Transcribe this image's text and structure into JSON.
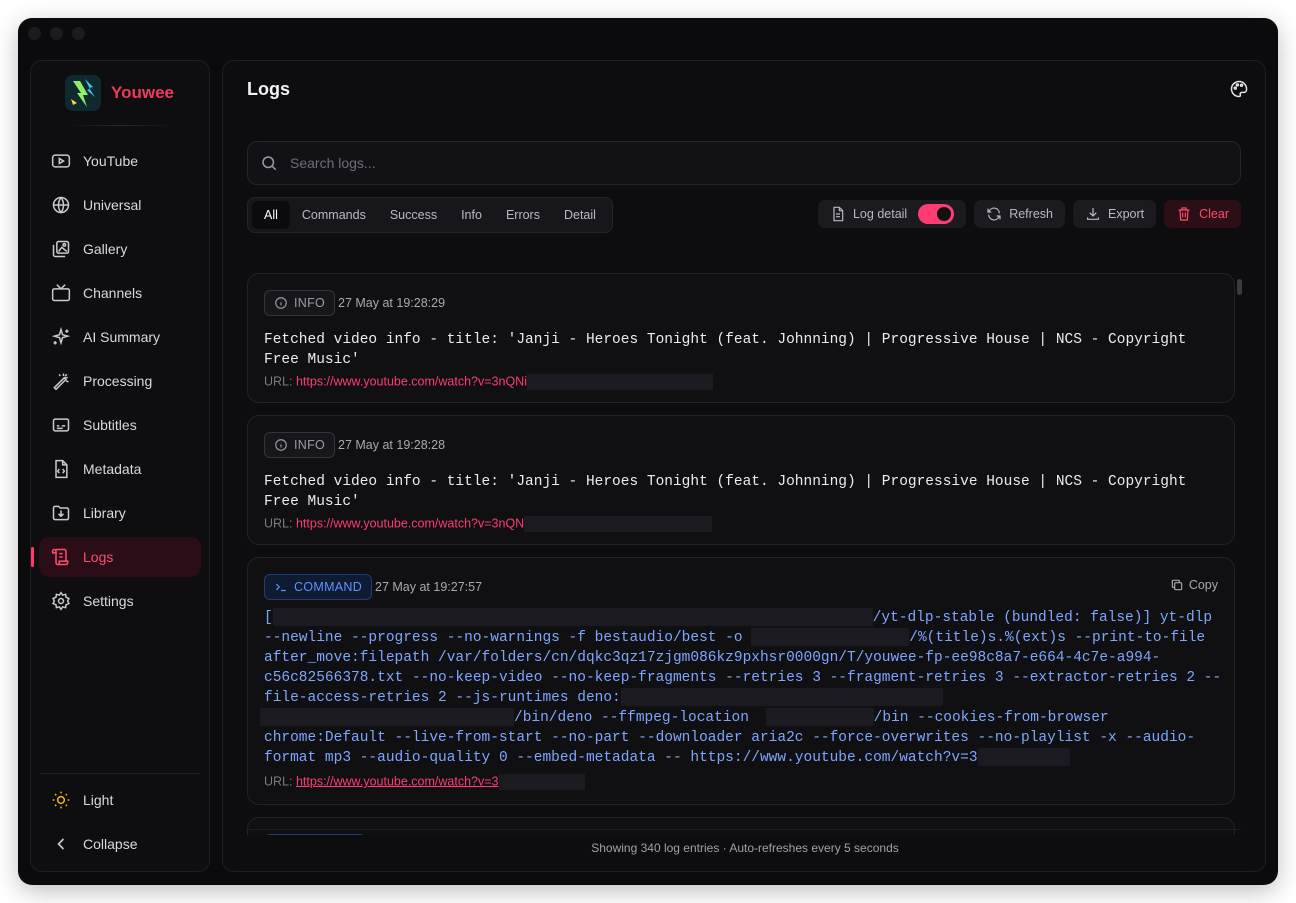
{
  "app": {
    "name": "Youwee"
  },
  "sidebar": {
    "items": [
      {
        "label": "YouTube",
        "icon": "youtube-icon"
      },
      {
        "label": "Universal",
        "icon": "globe-icon"
      },
      {
        "label": "Gallery",
        "icon": "gallery-icon"
      },
      {
        "label": "Channels",
        "icon": "tv-icon"
      },
      {
        "label": "AI Summary",
        "icon": "sparkles-icon"
      },
      {
        "label": "Processing",
        "icon": "magic-wand-icon"
      },
      {
        "label": "Subtitles",
        "icon": "subtitles-icon"
      },
      {
        "label": "Metadata",
        "icon": "file-code-icon"
      },
      {
        "label": "Library",
        "icon": "folder-download-icon"
      },
      {
        "label": "Logs",
        "icon": "scroll-icon",
        "active": true
      },
      {
        "label": "Settings",
        "icon": "gear-icon"
      }
    ],
    "theme_label": "Light",
    "collapse_label": "Collapse"
  },
  "header": {
    "title": "Logs"
  },
  "search": {
    "placeholder": "Search logs..."
  },
  "filters": {
    "all": "All",
    "commands": "Commands",
    "success": "Success",
    "info": "Info",
    "errors": "Errors",
    "detail": "Detail",
    "selected": "All"
  },
  "actions": {
    "log_detail": "Log detail",
    "log_detail_on": true,
    "refresh": "Refresh",
    "export": "Export",
    "clear": "Clear"
  },
  "logs": [
    {
      "type": "INFO",
      "timestamp": "27 May at 19:28:29",
      "message": "Fetched video info - title: 'Janji - Heroes Tonight (feat. Johnning) | Progressive House | NCS - Copyright Free Music'",
      "url_label": "URL:",
      "url": "https://www.youtube.com/watch?v=3nQNi"
    },
    {
      "type": "INFO",
      "timestamp": "27 May at 19:28:28",
      "message": "Fetched video info - title: 'Janji - Heroes Tonight (feat. Johnning) | Progressive House | NCS - Copyright Free Music'",
      "url_label": "URL:",
      "url": "https://www.youtube.com/watch?v=3nQN"
    },
    {
      "type": "COMMAND",
      "timestamp": "27 May at 19:27:57",
      "copy_label": "Copy",
      "command_parts": {
        "p1": "[",
        "p2": "/yt-dlp-stable (bundled: false)] yt-dlp",
        "p3": "--newline --progress --no-warnings -f bestaudio/best -o",
        "p4": "/%(title)s.%(ext)s --print-to-file",
        "p5": "after_move:filepath /var/folders/cn/dqkc3qz17zjgm086kz9pxhsr0000gn/T/youwee-fp-ee98c8a7-e664-4c7e-a994-",
        "p6": "c56c82566378.txt --no-keep-video --no-keep-fragments --retries 3 --fragment-retries 3 --extractor-retries 2 --",
        "p7": "file-access-retries 2 --js-runtimes deno:",
        "p8": "/bin/deno --ffmpeg-location",
        "p9": "/bin --cookies-from-browser",
        "p10": "chrome:Default --live-from-start --no-part --downloader aria2c --force-overwrites --no-playlist -x --audio-",
        "p11": "format mp3 --audio-quality 0 --embed-metadata -- https://www.youtube.com/watch?v=3"
      },
      "url_label": "URL:",
      "url": "https://www.youtube.com/watch?v=3"
    }
  ],
  "footer": {
    "status": "Showing 340 log entries · Auto-refreshes every 5 seconds"
  },
  "colors": {
    "accent": "#ff3b74",
    "brand": "#ef3b5b",
    "command": "#5b93ff",
    "background": "#0b0b0d"
  }
}
